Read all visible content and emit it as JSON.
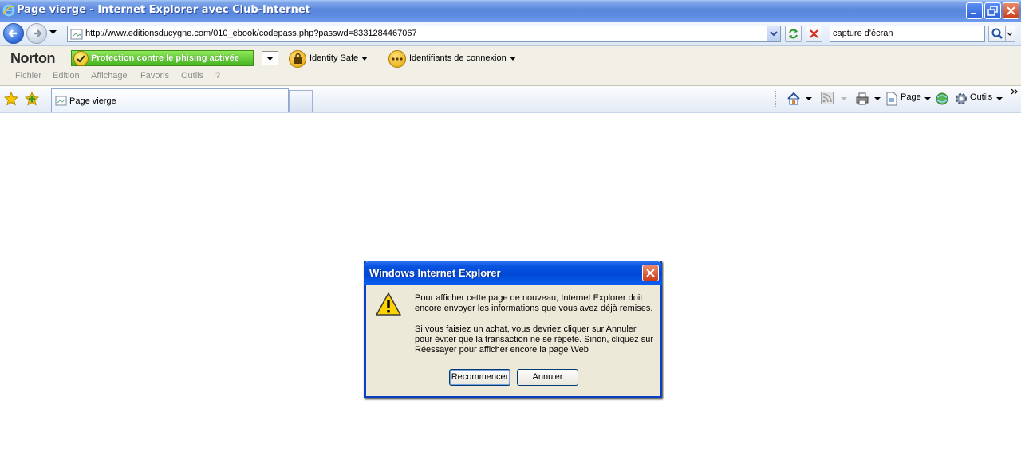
{
  "window": {
    "title": "Page vierge - Internet Explorer avec Club-Internet"
  },
  "address_bar": {
    "url": "http://www.editionsducygne.com/010_ebook/codepass.php?passwd=8331284467067",
    "search_value": "capture d'écran"
  },
  "norton": {
    "logo": "Norton",
    "phishing_label": "Protection contre le phising activée",
    "identity_safe": "Identity Safe",
    "login_ids": "Identifiants de connexion"
  },
  "menu": {
    "items": [
      "Fichier",
      "Edition",
      "Affichage",
      "Favoris",
      "Outils",
      "?"
    ]
  },
  "tabs": {
    "active_label": "Page vierge"
  },
  "command_bar": {
    "page_label": "Page",
    "tools_label": "Outils"
  },
  "dialog": {
    "title": "Windows Internet Explorer",
    "paragraph1": "Pour afficher cette page de nouveau, Internet Explorer doit\nencore envoyer les informations que vous avez déjà remises.",
    "paragraph2": "Si vous faisiez un achat, vous devriez cliquer sur Annuler\npour éviter que la transaction ne se répète.  Sinon, cliquez sur\nRéessayer pour afficher encore la page Web",
    "retry_label": "Recommencer",
    "cancel_label": "Annuler"
  },
  "colors": {
    "title_bar": "#5a87dc",
    "dialog_title": "#0047d5",
    "phishing_green": "#45b51f"
  }
}
